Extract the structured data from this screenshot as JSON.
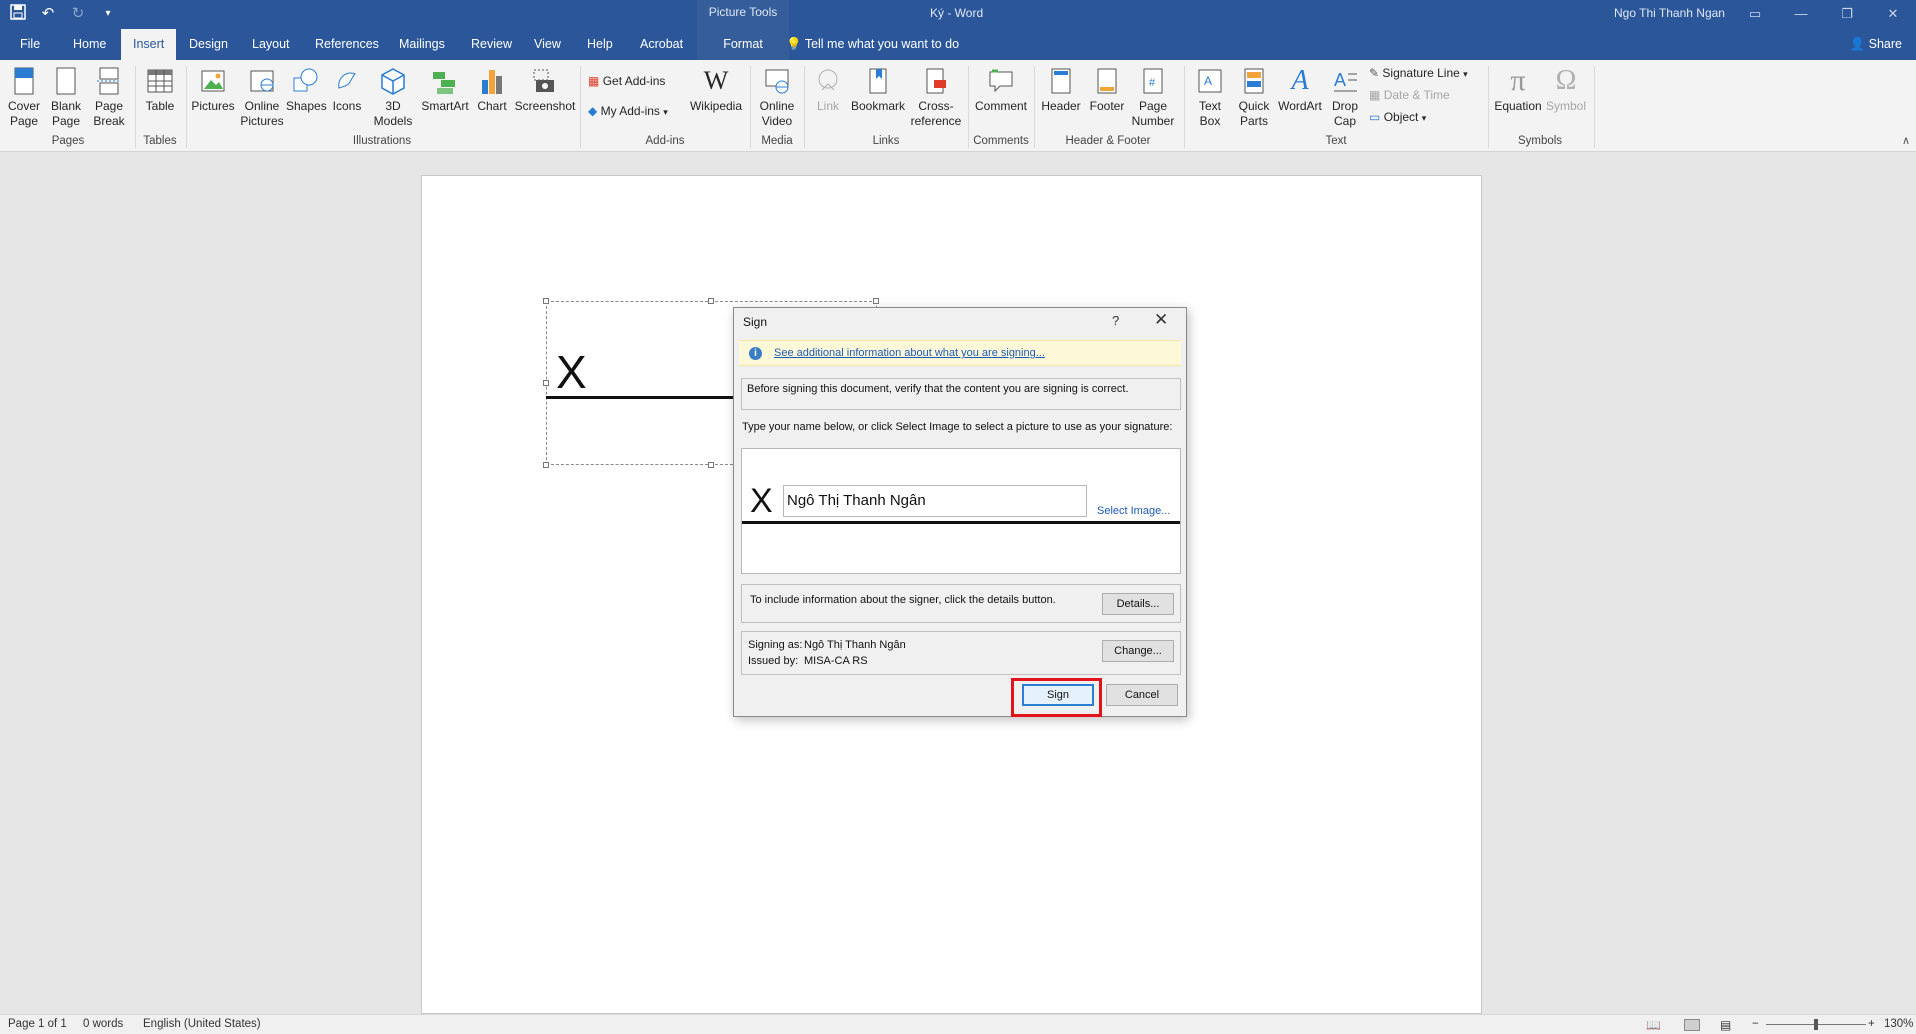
{
  "titlebar": {
    "context_header": "Picture Tools",
    "doc_title": "Ký  -  Word",
    "user": "Ngo Thi Thanh Ngan"
  },
  "tabs": [
    {
      "label": "File"
    },
    {
      "label": "Home"
    },
    {
      "label": "Insert"
    },
    {
      "label": "Design"
    },
    {
      "label": "Layout"
    },
    {
      "label": "References"
    },
    {
      "label": "Mailings"
    },
    {
      "label": "Review"
    },
    {
      "label": "View"
    },
    {
      "label": "Help"
    },
    {
      "label": "Acrobat"
    },
    {
      "label": "Format"
    }
  ],
  "tellme": "Tell me what you want to do",
  "share": "Share",
  "ribbon": {
    "pages": {
      "cover": "Cover\nPage",
      "blank": "Blank\nPage",
      "break": "Page\nBreak",
      "label": "Pages"
    },
    "tables": {
      "table": "Table",
      "label": "Tables"
    },
    "illustrations": {
      "pictures": "Pictures",
      "online_pictures": "Online\nPictures",
      "shapes": "Shapes",
      "icons": "Icons",
      "models": "3D\nModels",
      "smartart": "SmartArt",
      "chart": "Chart",
      "screenshot": "Screenshot",
      "label": "Illustrations"
    },
    "addins": {
      "get": "Get Add-ins",
      "my": "My Add-ins",
      "wikipedia": "Wikipedia",
      "label": "Add-ins"
    },
    "media": {
      "online_video": "Online\nVideo",
      "label": "Media"
    },
    "links": {
      "link": "Link",
      "bookmark": "Bookmark",
      "crossref": "Cross-\nreference",
      "label": "Links"
    },
    "comments": {
      "comment": "Comment",
      "label": "Comments"
    },
    "headerfooter": {
      "header": "Header",
      "footer": "Footer",
      "page_number": "Page\nNumber",
      "label": "Header & Footer"
    },
    "text": {
      "textbox": "Text\nBox",
      "quickparts": "Quick\nParts",
      "wordart": "WordArt",
      "dropcap": "Drop\nCap",
      "signature_line": "Signature Line",
      "date_time": "Date & Time",
      "object": "Object",
      "label": "Text"
    },
    "symbols": {
      "equation": "Equation",
      "symbol": "Symbol",
      "label": "Symbols"
    }
  },
  "dialog": {
    "title": "Sign",
    "help": "?",
    "close": "✕",
    "info_link": "See additional information about what you are signing...",
    "verify_text": "Before signing this document, verify that the content you are signing is correct.",
    "instruction": "Type your name below, or click Select Image to select a picture to use as your signature:",
    "x_mark": "X",
    "name_value": "Ngô Thị Thanh Ngân",
    "select_image": "Select Image...",
    "details_text": "To include information about the signer, click the details button.",
    "details_button": "Details...",
    "signing_as_label": "Signing as:",
    "signing_as_value": "Ngô Thị Thanh Ngân",
    "issued_by_label": "Issued by:",
    "issued_by_value": "MISA-CA RS",
    "change_button": "Change...",
    "sign_button": "Sign",
    "cancel_button": "Cancel"
  },
  "document": {
    "x_mark": "X"
  },
  "status": {
    "page": "Page 1 of 1",
    "words": "0 words",
    "language": "English (United States)",
    "zoom": "130%"
  }
}
